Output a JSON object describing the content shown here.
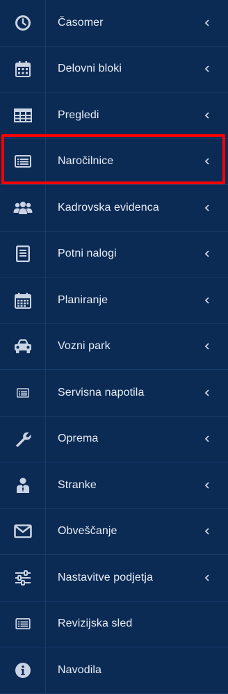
{
  "sidebar": {
    "items": [
      {
        "label": "Časomer",
        "icon": "clock-icon",
        "has_submenu": true
      },
      {
        "label": "Delovni bloki",
        "icon": "calendar-icon",
        "has_submenu": true
      },
      {
        "label": "Pregledi",
        "icon": "table-icon",
        "has_submenu": true
      },
      {
        "label": "Naročilnice",
        "icon": "list-card-icon",
        "has_submenu": true
      },
      {
        "label": "Kadrovska evidenca",
        "icon": "users-icon",
        "has_submenu": true
      },
      {
        "label": "Potni nalogi",
        "icon": "document-icon",
        "has_submenu": true
      },
      {
        "label": "Planiranje",
        "icon": "calendar-grid-icon",
        "has_submenu": true
      },
      {
        "label": "Vozni park",
        "icon": "car-icon",
        "has_submenu": true
      },
      {
        "label": "Servisna napotila",
        "icon": "list-card-icon",
        "has_submenu": true
      },
      {
        "label": "Oprema",
        "icon": "wrench-icon",
        "has_submenu": true
      },
      {
        "label": "Stranke",
        "icon": "person-tie-icon",
        "has_submenu": true
      },
      {
        "label": "Obveščanje",
        "icon": "envelope-icon",
        "has_submenu": true
      },
      {
        "label": "Nastavitve podjetja",
        "icon": "sliders-icon",
        "has_submenu": true
      },
      {
        "label": "Revizijska sled",
        "icon": "list-card-icon",
        "has_submenu": false
      },
      {
        "label": "Navodila",
        "icon": "info-icon",
        "has_submenu": false
      }
    ],
    "highlighted_item": "Naročilnice"
  },
  "colors": {
    "background": "#0b2a54",
    "divider": "#183d6b",
    "icon": "#c9d3e2",
    "text": "#e8eef7",
    "highlight": "#ff0000"
  }
}
